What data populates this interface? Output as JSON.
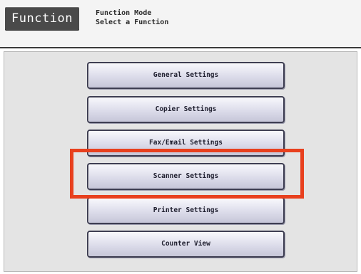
{
  "header": {
    "tab_label": "Function",
    "mode_line": "Function Mode",
    "instruction_line": "Select a Function"
  },
  "menu": {
    "items": [
      {
        "label": "General Settings"
      },
      {
        "label": "Copier Settings"
      },
      {
        "label": "Fax/Email Settings"
      },
      {
        "label": "Scanner Settings"
      },
      {
        "label": "Printer Settings"
      },
      {
        "label": "Counter View"
      }
    ]
  },
  "colors": {
    "highlight": "#e8401e",
    "tab_background": "#4a4a4a"
  }
}
